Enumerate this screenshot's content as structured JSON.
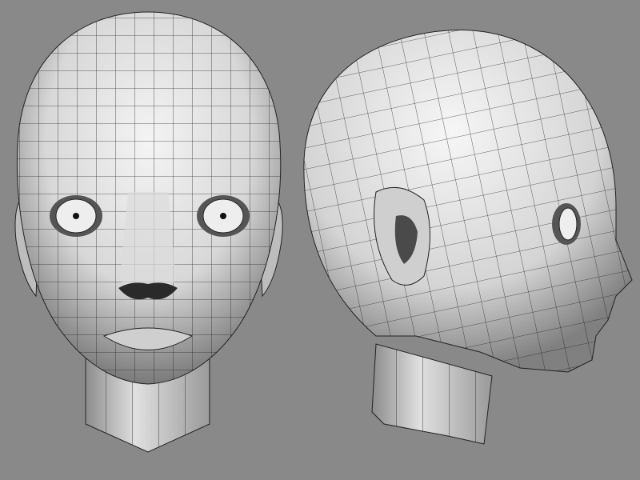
{
  "scene": {
    "background_color": "#898989",
    "mesh_color": "#e6e6e6",
    "wire_color": "#1a1a1a",
    "views": [
      {
        "name": "front-view",
        "subject": "head-mesh"
      },
      {
        "name": "side-view",
        "subject": "head-mesh"
      }
    ]
  }
}
